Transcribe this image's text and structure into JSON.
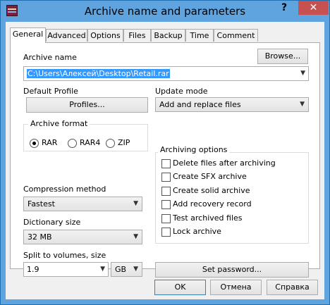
{
  "window": {
    "title": "Archive name and parameters",
    "help_glyph": "?",
    "close_glyph": "✕"
  },
  "tabs": [
    "General",
    "Advanced",
    "Options",
    "Files",
    "Backup",
    "Time",
    "Comment"
  ],
  "archive_name": {
    "label": "Archive name",
    "value": "C:\\Users\\Алексей\\Desktop\\Retail.rar",
    "browse_label": "Browse..."
  },
  "default_profile": {
    "label": "Default Profile",
    "button_label": "Profiles..."
  },
  "update_mode": {
    "label": "Update mode",
    "value": "Add and replace files"
  },
  "archive_format": {
    "title": "Archive format",
    "options": [
      "RAR",
      "RAR4",
      "ZIP"
    ],
    "selected": "RAR"
  },
  "archiving_options": {
    "title": "Archiving options",
    "items": [
      {
        "label": "Delete files after archiving",
        "checked": false
      },
      {
        "label": "Create SFX archive",
        "checked": false
      },
      {
        "label": "Create solid archive",
        "checked": false
      },
      {
        "label": "Add recovery record",
        "checked": false
      },
      {
        "label": "Test archived files",
        "checked": false
      },
      {
        "label": "Lock archive",
        "checked": false
      }
    ]
  },
  "compression_method": {
    "label": "Compression method",
    "value": "Fastest"
  },
  "dictionary_size": {
    "label": "Dictionary size",
    "value": "32 MB"
  },
  "split_volumes": {
    "label": "Split to volumes, size",
    "value": "1.9",
    "unit": "GB"
  },
  "set_password_label": "Set password...",
  "footer": {
    "ok": "OK",
    "cancel": "Отмена",
    "help": "Справка"
  },
  "dropdown_glyph": "▼"
}
